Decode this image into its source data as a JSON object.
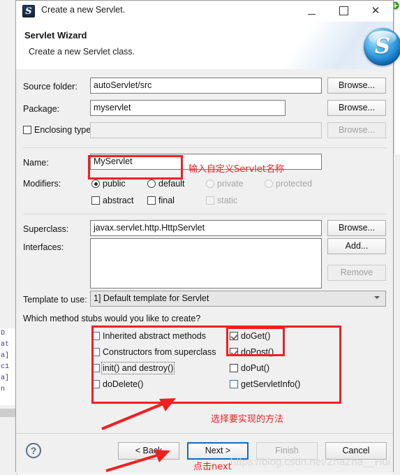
{
  "window": {
    "title": "Create a new Servlet.",
    "icon": "servlet-icon",
    "minimize_label": "—",
    "maximize_label": "□",
    "close_label": "✕"
  },
  "header": {
    "title": "Servlet Wizard",
    "subtitle": "Create a new Servlet class.",
    "logo_glyph": "S"
  },
  "form": {
    "source_folder": {
      "label": "Source folder:",
      "value": "autoServlet/src",
      "browse": "Browse..."
    },
    "package": {
      "label": "Package:",
      "value": "myservlet",
      "browse": "Browse..."
    },
    "enclosing_type": {
      "label": "Enclosing type:",
      "value": "",
      "browse": "Browse...",
      "checked": false
    },
    "name": {
      "label": "Name:",
      "value": "MyServlet"
    },
    "modifiers": {
      "label": "Modifiers:",
      "radios": [
        {
          "label": "public",
          "selected": true,
          "disabled": false
        },
        {
          "label": "default",
          "selected": false,
          "disabled": false
        },
        {
          "label": "private",
          "selected": false,
          "disabled": true
        },
        {
          "label": "protected",
          "selected": false,
          "disabled": true
        }
      ],
      "checks": [
        {
          "label": "abstract",
          "checked": false,
          "disabled": false
        },
        {
          "label": "final",
          "checked": false,
          "disabled": false
        },
        {
          "label": "static",
          "checked": false,
          "disabled": true
        }
      ]
    },
    "superclass": {
      "label": "Superclass:",
      "value": "javax.servlet.http.HttpServlet",
      "browse": "Browse..."
    },
    "interfaces": {
      "label": "Interfaces:",
      "value": "",
      "add": "Add...",
      "remove": "Remove"
    },
    "template": {
      "label": "Template to use:",
      "value": "1] Default template for Servlet"
    }
  },
  "stubs": {
    "question": "Which method stubs would you like to create?",
    "left_column": [
      {
        "label": "Inherited abstract methods",
        "checked": false
      },
      {
        "label": "Constructors from superclass",
        "checked": false
      },
      {
        "label": "init() and destroy()",
        "checked": false,
        "focused": true
      },
      {
        "label": "doDelete()",
        "checked": false
      }
    ],
    "right_column": [
      {
        "label": "doGet()",
        "checked": true
      },
      {
        "label": "doPost()",
        "checked": true
      },
      {
        "label": "doPut()",
        "checked": false
      },
      {
        "label": "getServletInfo()",
        "checked": false
      }
    ]
  },
  "footer": {
    "help": "?",
    "buttons": [
      {
        "label": "< Back",
        "state": "normal"
      },
      {
        "label": "Next >",
        "state": "focused"
      },
      {
        "label": "Finish",
        "state": "disabled"
      },
      {
        "label": "Cancel",
        "state": "normal"
      }
    ]
  },
  "annotations": {
    "name_hint": "输入自定义Servlet名称",
    "stubs_hint": "选择要实现的方法",
    "next_hint": "点击next",
    "accent_color": "#f02020"
  },
  "watermark": {
    "text": "https://blog.csdn.net/ZhaZha__Hui"
  },
  "background": {
    "editor_lines": [
      "D",
      "at",
      "a]",
      "c1",
      "a]",
      "n"
    ]
  }
}
